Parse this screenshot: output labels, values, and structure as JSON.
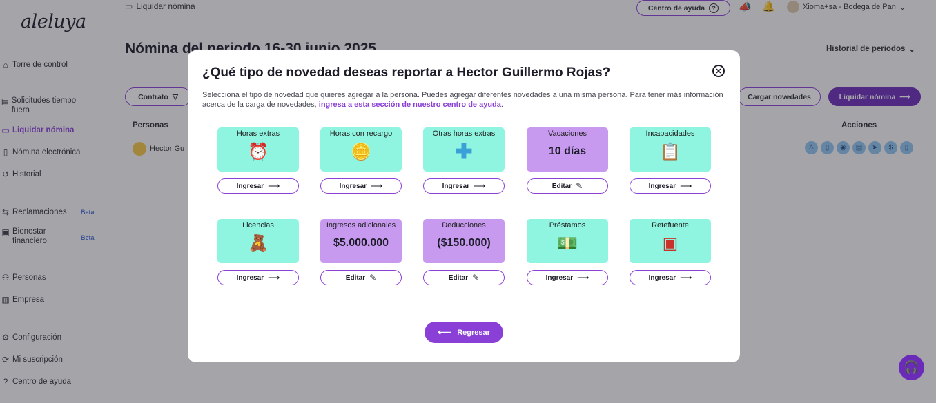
{
  "app": {
    "logo": "aleluya",
    "breadcrumb": "Liquidar nómina",
    "help_center": "Centro de ayuda",
    "user": "Xioma+sa - Bodega de Pan"
  },
  "sidebar": {
    "items": [
      {
        "label": "Torre de control"
      },
      {
        "label": "Solicitudes tiempo fuera"
      },
      {
        "label": "Liquidar nómina"
      },
      {
        "label": "Nómina electrónica"
      },
      {
        "label": "Historial"
      },
      {
        "label": "Reclamaciones",
        "badge": "Beta"
      },
      {
        "label": "Bienestar financiero",
        "badge": "Beta"
      },
      {
        "label": "Personas"
      },
      {
        "label": "Empresa"
      },
      {
        "label": "Configuración"
      },
      {
        "label": "Mi suscripción"
      },
      {
        "label": "Centro de ayuda"
      }
    ]
  },
  "main": {
    "title": "Nómina del periodo 16-30 junio 2025",
    "history_link": "Historial de periodos",
    "filter_contract": "Contrato",
    "load_button": "Cargar novedades",
    "liquidate_button": "Liquidar nómina",
    "col_people": "Personas",
    "col_actions": "Acciones",
    "row_person": "Hector Gu"
  },
  "modal": {
    "title": "¿Qué tipo de novedad deseas reportar a Hector Guillermo Rojas?",
    "description": "Selecciona el tipo de novedad que quieres agregar a la persona. Puedes agregar diferentes novedades a una misma persona. Para tener más información acerca de la carga de novedades, ",
    "description_link": "ingresa a esta sección de nuestro centro de ayuda",
    "description_end": ".",
    "back_button": "Regresar",
    "cards": [
      {
        "label": "Horas extras",
        "button": "Ingresar",
        "mode": "ingresar",
        "icon": "alarm-clock-icon"
      },
      {
        "label": "Horas con recargo",
        "button": "Ingresar",
        "mode": "ingresar",
        "icon": "coin-icon"
      },
      {
        "label": "Otras horas extras",
        "button": "Ingresar",
        "mode": "ingresar",
        "icon": "plus-icon"
      },
      {
        "label": "Vacaciones",
        "value": "10 días",
        "button": "Editar",
        "mode": "editar"
      },
      {
        "label": "Incapacidades",
        "button": "Ingresar",
        "mode": "ingresar",
        "icon": "clipboard-icon"
      },
      {
        "label": "Licencias",
        "button": "Ingresar",
        "mode": "ingresar",
        "icon": "baby-icon"
      },
      {
        "label": "Ingresos adicionales",
        "value": "$5.000.000",
        "button": "Editar",
        "mode": "editar"
      },
      {
        "label": "Deducciones",
        "value": "($150.000)",
        "button": "Editar",
        "mode": "editar"
      },
      {
        "label": "Préstamos",
        "button": "Ingresar",
        "mode": "ingresar",
        "icon": "money-icon"
      },
      {
        "label": "Retefuente",
        "button": "Ingresar",
        "mode": "ingresar",
        "icon": "safe-icon"
      }
    ]
  },
  "colors": {
    "accent": "#8a3fd6",
    "teal_card": "#8ff5e0",
    "purple_card": "#c79af0"
  }
}
